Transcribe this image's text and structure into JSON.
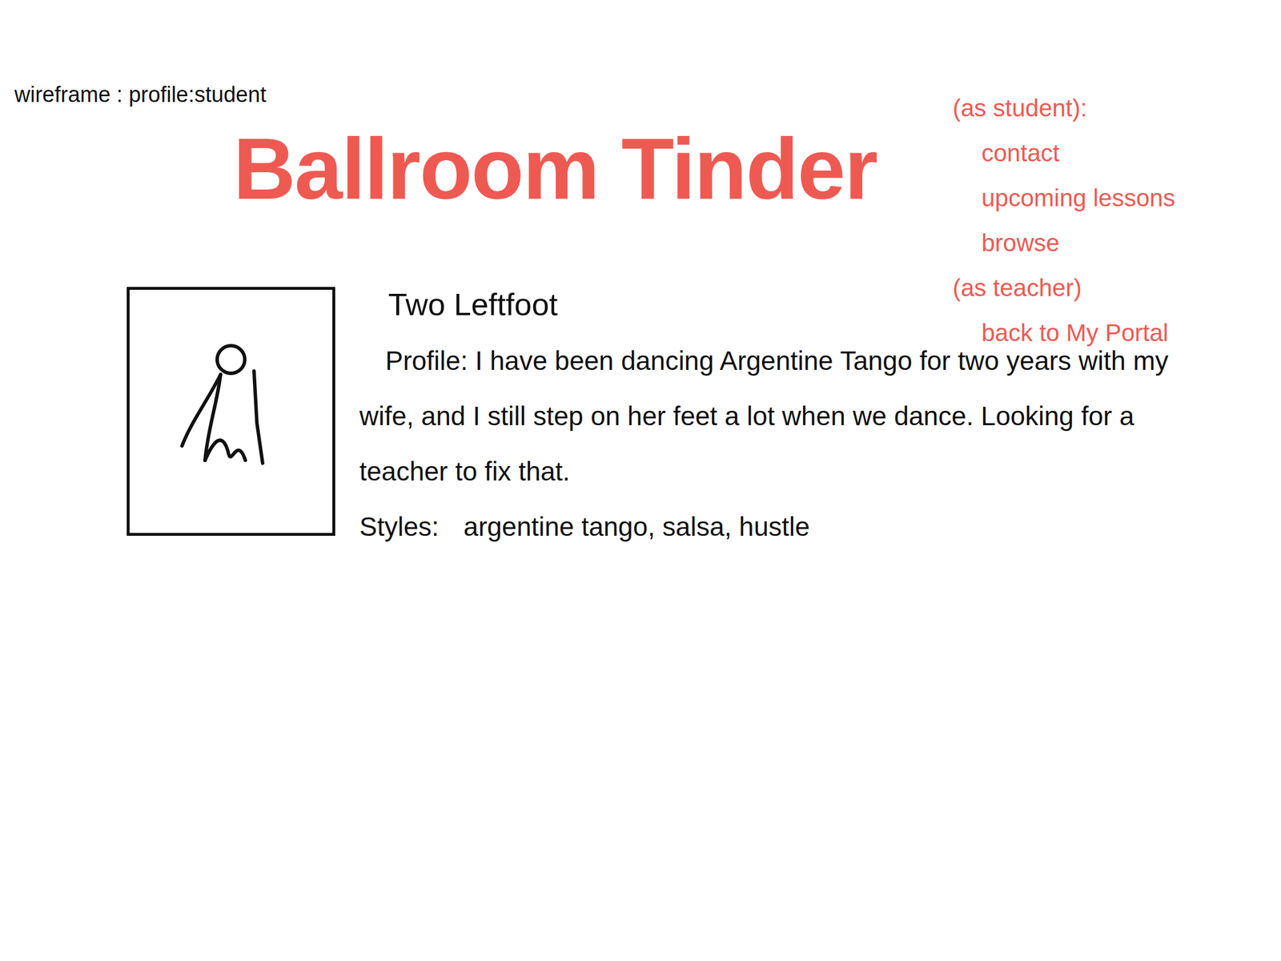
{
  "page_label": "wireframe : profile:student",
  "logo": "Ballroom Tinder",
  "nav": [
    {
      "label": "(as student):",
      "kind": "heading"
    },
    {
      "label": "contact",
      "kind": "link"
    },
    {
      "label": "upcoming lessons",
      "kind": "link"
    },
    {
      "label": "browse",
      "kind": "link"
    },
    {
      "label": "(as teacher)",
      "kind": "heading"
    },
    {
      "label": "back to My Portal",
      "kind": "link"
    }
  ],
  "profile": {
    "name": "Two Leftfoot",
    "bio_label": "Profile:",
    "bio": "I have been dancing Argentine Tango for two years with my wife, and I still step on her feet a lot when we dance. Looking for a teacher to fix that.",
    "styles_label": "Styles:",
    "styles": "argentine tango, salsa, hustle"
  }
}
